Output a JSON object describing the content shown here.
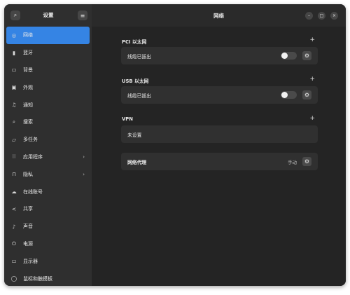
{
  "sidebar": {
    "title": "设置",
    "search_icon": "search-icon",
    "menu_icon": "hamburger-menu-icon",
    "accent": "#3584e4",
    "items": [
      {
        "label": "网络",
        "icon": "network-icon",
        "glyph": "◎",
        "active": true,
        "has_chevron": false
      },
      {
        "label": "蓝牙",
        "icon": "bluetooth-icon",
        "glyph": "▮",
        "active": false,
        "has_chevron": false
      },
      {
        "label": "背景",
        "icon": "background-icon",
        "glyph": "▭",
        "active": false,
        "has_chevron": false
      },
      {
        "label": "外观",
        "icon": "appearance-icon",
        "glyph": "▣",
        "active": false,
        "has_chevron": false
      },
      {
        "label": "通知",
        "icon": "bell-icon",
        "glyph": "♫",
        "active": false,
        "has_chevron": false
      },
      {
        "label": "搜索",
        "icon": "search-icon",
        "glyph": "⌕",
        "active": false,
        "has_chevron": false
      },
      {
        "label": "多任务",
        "icon": "multitasking-icon",
        "glyph": "▱",
        "active": false,
        "has_chevron": false
      },
      {
        "label": "应用程序",
        "icon": "apps-grid-icon",
        "glyph": "⁝⁝",
        "active": false,
        "has_chevron": true
      },
      {
        "label": "隐私",
        "icon": "lock-icon",
        "glyph": "⊓",
        "active": false,
        "has_chevron": true
      },
      {
        "label": "在线账号",
        "icon": "cloud-icon",
        "glyph": "☁",
        "active": false,
        "has_chevron": false
      },
      {
        "label": "共享",
        "icon": "share-icon",
        "glyph": "<",
        "active": false,
        "has_chevron": false
      },
      {
        "label": "声音",
        "icon": "music-note-icon",
        "glyph": "♪",
        "active": false,
        "has_chevron": false
      },
      {
        "label": "电源",
        "icon": "power-icon",
        "glyph": "⏻",
        "active": false,
        "has_chevron": false
      },
      {
        "label": "显示器",
        "icon": "display-icon",
        "glyph": "▭",
        "active": false,
        "has_chevron": false
      },
      {
        "label": "鼠标和触摸板",
        "icon": "mouse-icon",
        "glyph": "◯",
        "active": false,
        "has_chevron": false
      }
    ]
  },
  "header": {
    "title": "网络",
    "minimize_glyph": "–",
    "maximize_glyph": "□",
    "close_glyph": "×"
  },
  "sections": {
    "pci": {
      "title": "PCI 以太网",
      "add": "+",
      "row_label": "线缆已拔出",
      "toggle_on": false
    },
    "usb": {
      "title": "USB 以太网",
      "add": "+",
      "row_label": "线缆已拔出",
      "toggle_on": false
    },
    "vpn": {
      "title": "VPN",
      "add": "+",
      "row_label": "未设置"
    },
    "proxy": {
      "label": "网络代理",
      "status": "手动"
    }
  },
  "icons": {
    "gear": "⚙",
    "chevron": "›"
  }
}
